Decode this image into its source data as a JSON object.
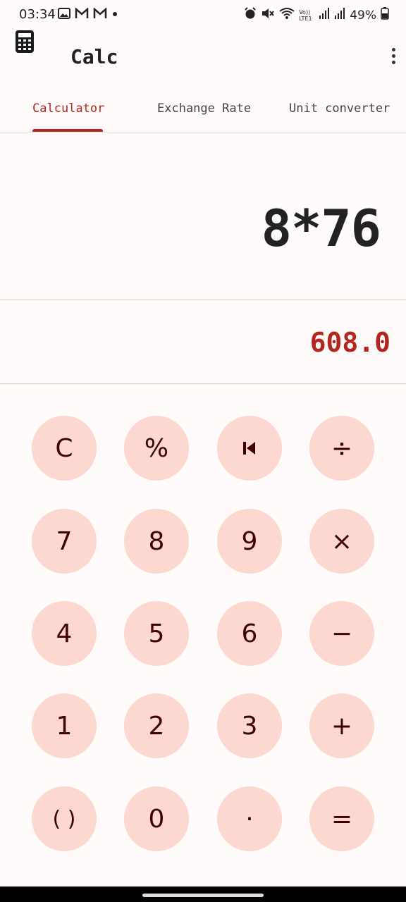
{
  "status_bar": {
    "time": "03:34",
    "network_label": "Vo)) LTE1",
    "battery_percent": "49%",
    "left_icons": [
      "gallery-icon",
      "gmail-icon",
      "gmail-icon",
      "notification-dot-icon"
    ],
    "right_icons": [
      "alarm-icon",
      "mute-icon",
      "wifi-icon",
      "signal-icon",
      "signal-icon",
      "battery-icon"
    ]
  },
  "app_bar": {
    "title": "Calc",
    "app_icon": "calculator-icon",
    "menu_icon": "more-vert-icon"
  },
  "tabs": [
    {
      "label": "Calculator",
      "active": true
    },
    {
      "label": "Exchange Rate",
      "active": false
    },
    {
      "label": "Unit converter",
      "active": false
    }
  ],
  "display": {
    "expression": "8*76",
    "result": "608.0"
  },
  "keypad": {
    "rows": [
      [
        "C",
        "%",
        "backspace",
        "÷"
      ],
      [
        "7",
        "8",
        "9",
        "×"
      ],
      [
        "4",
        "5",
        "6",
        "−"
      ],
      [
        "1",
        "2",
        "3",
        "+"
      ],
      [
        "( )",
        "0",
        "·",
        "="
      ]
    ],
    "clear": "C",
    "percent": "%",
    "backspace_icon": "backspace-icon",
    "divide": "÷",
    "seven": "7",
    "eight": "8",
    "nine": "9",
    "multiply": "×",
    "four": "4",
    "five": "5",
    "six": "6",
    "minus": "−",
    "one": "1",
    "two": "2",
    "three": "3",
    "plus": "+",
    "parentheses": "( )",
    "zero": "0",
    "decimal": "·",
    "equals": "=",
    "colors": {
      "key_bg": "#fcd8d0",
      "key_text": "#410002",
      "accent": "#b3261e"
    }
  }
}
